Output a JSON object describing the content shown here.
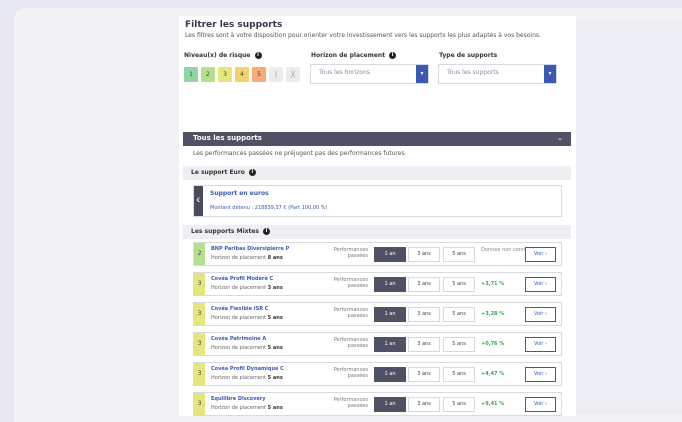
{
  "filters": {
    "title": "Filtrer les supports",
    "description": "Les filtres sont à votre disposition pour orienter votre investissement vers les supports les plus adaptés à vos besoins.",
    "risk_label": "Niveau(x) de risque",
    "risk_levels": [
      "1",
      "2",
      "3",
      "4",
      "5"
    ],
    "horizon_label": "Horizon de placement",
    "horizon_value": "Tous les horizons",
    "type_label": "Type de supports",
    "type_value": "Tous les supports"
  },
  "all_supports": {
    "title": "Tous les supports",
    "disclaimer": "Les performances passées ne préjugent pas des performances futures",
    "euro_section": "Le support Euro",
    "euro_card": {
      "symbol": "€",
      "name": "Support en euros",
      "amount": "Montant détenu : 218839,37 € (Part 100,00 %)"
    },
    "mixed_section": "Les supports Mixtes"
  },
  "fund_row_labels": {
    "perf_label": "Performances passées",
    "btn_1": "1 an",
    "btn_3": "3 ans",
    "btn_5": "5 ans",
    "voir": "Voir ›"
  },
  "funds": [
    {
      "risk": "2",
      "name": "BNP Paribas Diversipierre P",
      "horizon_prefix": "Horizon de placement",
      "horizon": "8 ans",
      "perf": "Donnée non connue"
    },
    {
      "risk": "3",
      "name": "Covéa Profil Modéré C",
      "horizon_prefix": "Horizon de placement",
      "horizon": "3 ans",
      "perf": "+3,71 %"
    },
    {
      "risk": "3",
      "name": "Covéa Flexible ISR C",
      "horizon_prefix": "Horizon de placement",
      "horizon": "5 ans",
      "perf": "+3,28 %"
    },
    {
      "risk": "3",
      "name": "Covéa Patrimoine A",
      "horizon_prefix": "Horizon de placement",
      "horizon": "5 ans",
      "perf": "+0,76 %"
    },
    {
      "risk": "3",
      "name": "Covéa Profil Dynamique C",
      "horizon_prefix": "Horizon de placement",
      "horizon": "5 ans",
      "perf": "+4,47 %"
    },
    {
      "risk": "3",
      "name": "Equilibre Discovery",
      "horizon_prefix": "Horizon de placement",
      "horizon": "5 ans",
      "perf": "+9,41 %"
    }
  ],
  "colors": {
    "accent": "#3a5ab2",
    "dark_bar": "#4e5264",
    "positive": "#34a853"
  }
}
